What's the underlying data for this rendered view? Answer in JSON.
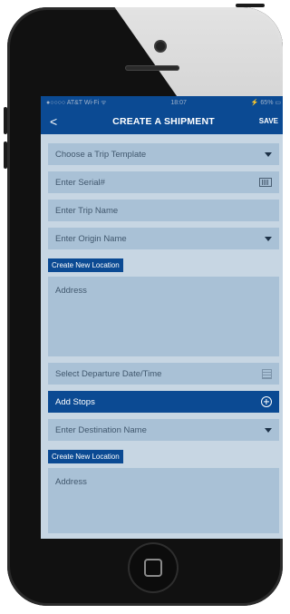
{
  "status_bar": {
    "carrier": "●○○○○ AT&T Wi-Fi ᯤ",
    "time": "18:07",
    "battery": "⚡ 65% ▭"
  },
  "nav": {
    "back_symbol": "<",
    "title": "CREATE A SHIPMENT",
    "save_label": "SAVE"
  },
  "form": {
    "trip_template_placeholder": "Choose a Trip Template",
    "serial_placeholder": "Enter Serial#",
    "trip_name_placeholder": "Enter Trip Name",
    "origin_placeholder": "Enter Origin Name",
    "create_origin_location_label": "Create New Location",
    "origin_address_placeholder": "Address",
    "departure_placeholder": "Select Departure Date/Time",
    "add_stops_label": "Add Stops",
    "destination_placeholder": "Enter Destination Name",
    "create_destination_location_label": "Create New Location",
    "destination_address_placeholder": "Address"
  },
  "icons": {
    "dropdown": "chevron-down-icon",
    "barcode": "barcode-scan-icon",
    "calendar": "calendar-icon",
    "add": "add-circle-icon"
  },
  "colors": {
    "primary": "#0b4a93",
    "field_bg": "#a9c1d6",
    "screen_bg": "#c7d6e3"
  }
}
